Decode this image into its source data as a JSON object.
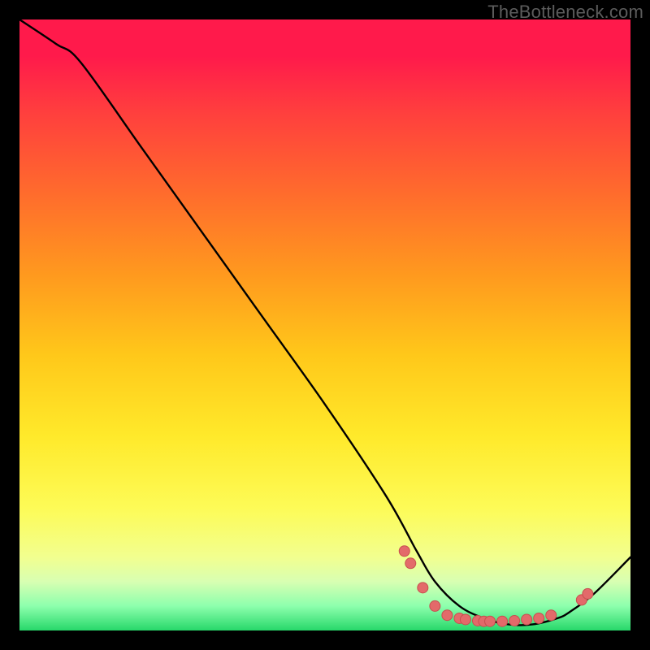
{
  "watermark": "TheBottleneck.com",
  "chart_data": {
    "type": "line",
    "title": "",
    "xlabel": "",
    "ylabel": "",
    "xlim": [
      0,
      100
    ],
    "ylim": [
      0,
      100
    ],
    "series": [
      {
        "name": "bottleneck-curve",
        "x": [
          0,
          6,
          10,
          20,
          30,
          40,
          50,
          60,
          65,
          68,
          72,
          76,
          80,
          84,
          88,
          90,
          94,
          100
        ],
        "y": [
          100,
          96,
          93,
          79,
          65,
          51,
          37,
          22,
          13,
          8,
          4,
          2,
          1,
          1,
          2,
          3,
          6,
          12
        ]
      }
    ],
    "markers": [
      {
        "x": 63,
        "y": 13
      },
      {
        "x": 64,
        "y": 11
      },
      {
        "x": 66,
        "y": 7
      },
      {
        "x": 68,
        "y": 4
      },
      {
        "x": 70,
        "y": 2.5
      },
      {
        "x": 72,
        "y": 2
      },
      {
        "x": 73,
        "y": 1.8
      },
      {
        "x": 75,
        "y": 1.6
      },
      {
        "x": 76,
        "y": 1.5
      },
      {
        "x": 77,
        "y": 1.5
      },
      {
        "x": 79,
        "y": 1.5
      },
      {
        "x": 81,
        "y": 1.6
      },
      {
        "x": 83,
        "y": 1.8
      },
      {
        "x": 85,
        "y": 2
      },
      {
        "x": 87,
        "y": 2.5
      },
      {
        "x": 92,
        "y": 5
      },
      {
        "x": 93,
        "y": 6
      }
    ],
    "colors": {
      "line": "#000000",
      "marker_fill": "#e36a6a",
      "marker_stroke": "#c74f4f"
    }
  }
}
